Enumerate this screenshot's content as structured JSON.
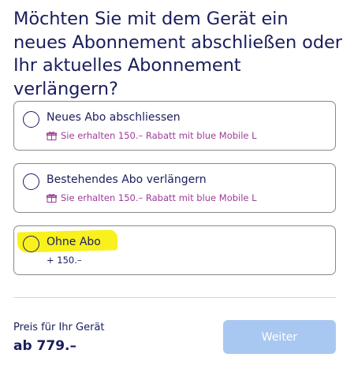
{
  "question": "Möchten Sie mit dem Gerät ein neues Abonnement abschließen oder Ihr aktuelles Abonnement verlängern?",
  "options": [
    {
      "label": "Neues Abo abschliessen",
      "sub": "Sie erhalten 150.– Rabatt mit blue Mobile L",
      "sub_icon": "gift-icon",
      "selected": false
    },
    {
      "label": "Bestehendes Abo verlängern",
      "sub": "Sie erhalten 150.– Rabatt mit blue Mobile L",
      "sub_icon": "gift-icon",
      "selected": false
    },
    {
      "label": "Ohne Abo",
      "sub": "+ 150.–",
      "selected": false,
      "highlighted": true
    }
  ],
  "footer": {
    "price_label": "Preis für Ihr Gerät",
    "price_value": "ab 779.–",
    "continue_label": "Weiter",
    "continue_disabled": true
  },
  "colors": {
    "text": "#1a1e5c",
    "promo": "#9c3d98",
    "highlight": "#f8f11d",
    "button_disabled": "#a9c8f1",
    "border": "#8a8a8a"
  }
}
